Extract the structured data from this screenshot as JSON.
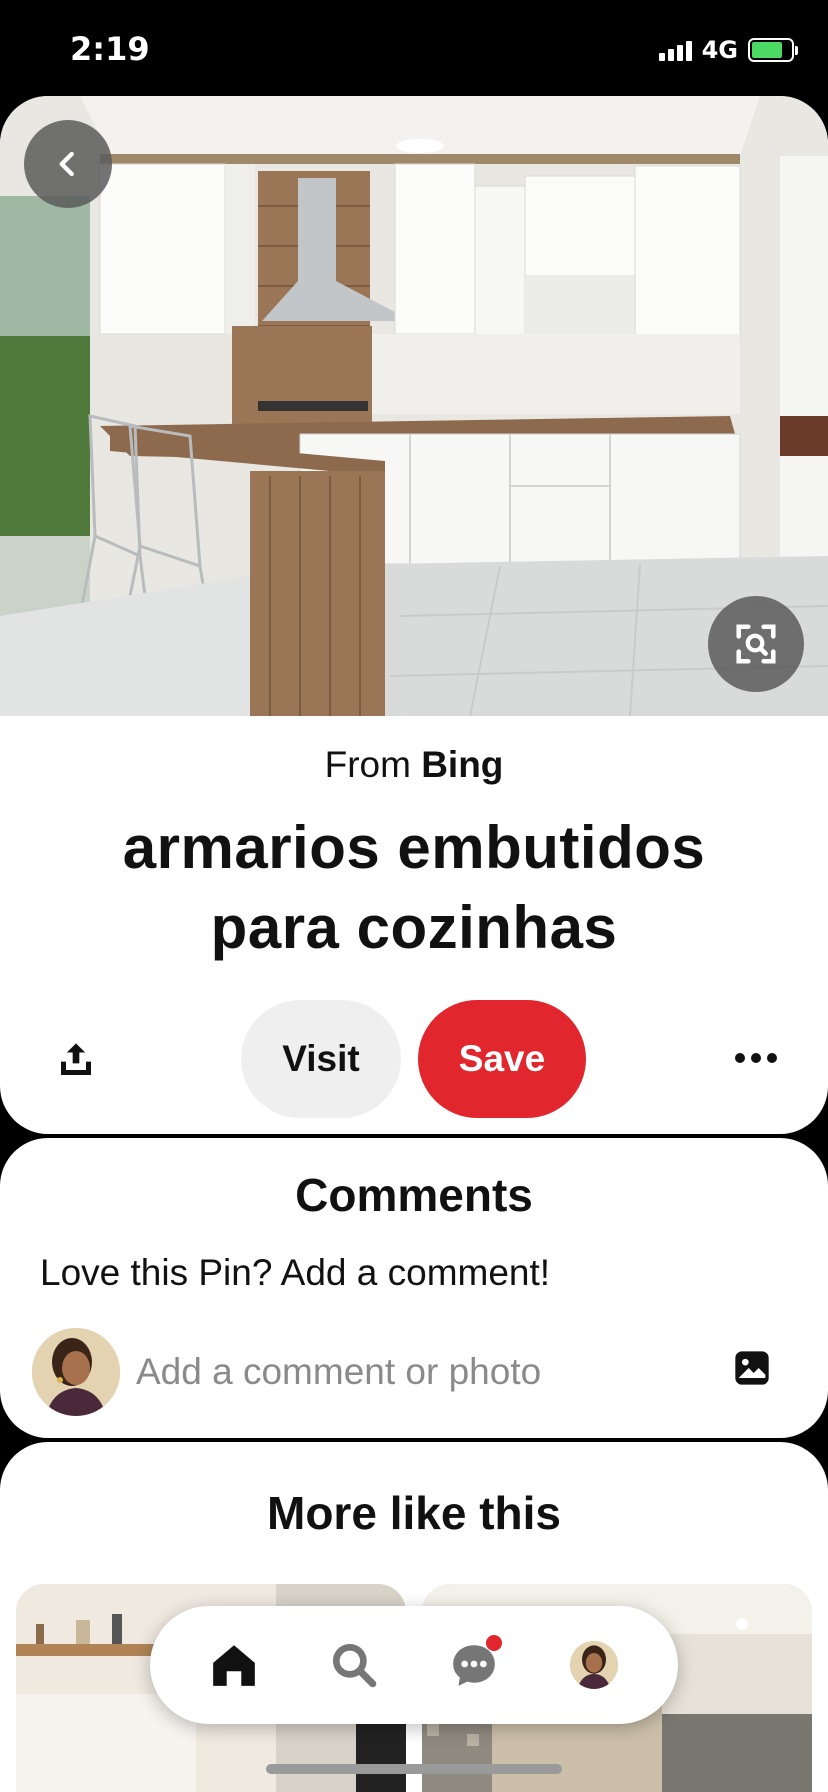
{
  "status_bar": {
    "time": "2:19",
    "network": "4G",
    "battery_level": 0.8,
    "battery_color": "#4cd964"
  },
  "pin": {
    "source_prefix": "From",
    "source_name": "Bing",
    "title": "armarios embutidos para cozinhas",
    "back_icon": "chevron-left-icon",
    "lens_icon": "visual-search-icon"
  },
  "actions": {
    "share_icon": "share-icon",
    "visit_label": "Visit",
    "save_label": "Save",
    "save_color": "#e1262e",
    "more_icon": "ellipsis-icon"
  },
  "comments": {
    "title": "Comments",
    "prompt": "Love this Pin? Add a comment!",
    "input_placeholder": "Add a comment or photo",
    "photo_icon": "image-icon"
  },
  "more_like_this": {
    "title": "More like this"
  },
  "bottom_nav": {
    "items": [
      {
        "icon": "home-icon",
        "active": true
      },
      {
        "icon": "search-icon",
        "active": false
      },
      {
        "icon": "messages-icon",
        "active": false,
        "has_notification": true
      },
      {
        "icon": "profile-avatar",
        "active": false
      }
    ]
  }
}
